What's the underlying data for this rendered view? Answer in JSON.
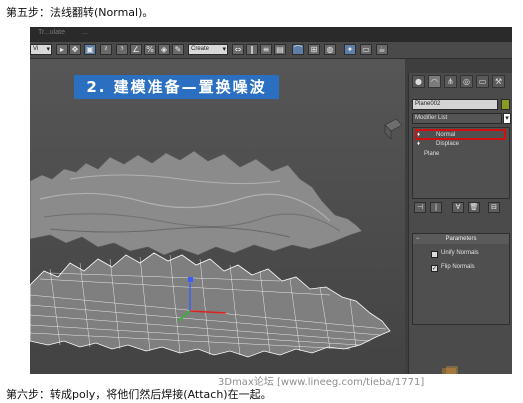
{
  "captions": {
    "step5": "第五步：法线翻转(Normal)。",
    "step6": "第六步：转成poly，将他们然后焊接(Attach)在一起。"
  },
  "menubar": {
    "item_a": "Tr...ulate",
    "item_b": "..."
  },
  "toolbar": {
    "selection_set_placeholder": "Create Selection Se",
    "view_dropdown": "Vi"
  },
  "viewport": {
    "banner_title": "2. 建模准备—置换噪波"
  },
  "command_panel": {
    "object_name": "Plane002",
    "modifier_list": "Modifier List",
    "modifier_stack": [
      {
        "label": "Normal",
        "highlighted": true
      },
      {
        "label": "Displace",
        "highlighted": false
      },
      {
        "label": "Plane",
        "highlighted": false
      }
    ],
    "parameters_title": "Parameters",
    "params": [
      {
        "label": "Unify Normals",
        "checked": false
      },
      {
        "label": "Flip Normals",
        "checked": true
      }
    ]
  },
  "watermark": {
    "text": "3Dmax论坛 [www.lineeg.com/tieba/1771]"
  },
  "colors": {
    "banner_bg": "#2b6fc0",
    "highlight_border": "#d01010",
    "object_color": "#8a9a22"
  }
}
